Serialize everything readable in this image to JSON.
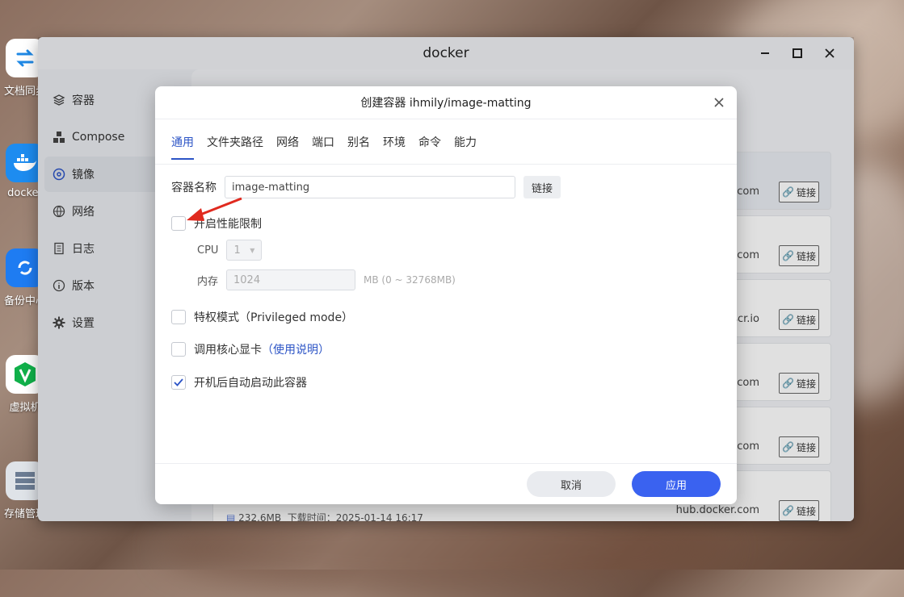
{
  "desktop": {
    "icons": [
      {
        "label": "文档同步"
      },
      {
        "label": "docker"
      },
      {
        "label": "备份中心"
      },
      {
        "label": "虚拟机"
      },
      {
        "label": "存储管理"
      }
    ]
  },
  "window": {
    "title": "docker",
    "sidebar": [
      {
        "label": "容器",
        "icon": "layers-icon"
      },
      {
        "label": "Compose",
        "icon": "boxes-icon"
      },
      {
        "label": "镜像",
        "icon": "disc-icon"
      },
      {
        "label": "网络",
        "icon": "globe-icon"
      },
      {
        "label": "日志",
        "icon": "document-icon"
      },
      {
        "label": "版本",
        "icon": "info-icon"
      },
      {
        "label": "设置",
        "icon": "gear-icon"
      }
    ],
    "image_rows": [
      {
        "source": "docker.com",
        "link_label": "链接"
      },
      {
        "source": "docker.com",
        "link_label": "链接"
      },
      {
        "source": "lscr.io",
        "link_label": "链接"
      },
      {
        "source": "docker.com",
        "link_label": "链接"
      },
      {
        "source": "docker.com",
        "link_label": "链接"
      },
      {
        "source": "hub.docker.com",
        "link_label": "链接",
        "size": "232.6MB",
        "download_time": "下载时间：2025-01-14 16:17"
      }
    ]
  },
  "modal": {
    "title": "创建容器 ihmily/image-matting",
    "tabs": [
      "通用",
      "文件夹路径",
      "网络",
      "端口",
      "别名",
      "环境",
      "命令",
      "能力"
    ],
    "active_tab": "通用",
    "container_name_label": "容器名称",
    "container_name_value": "image-matting",
    "link_button": "链接",
    "perf_limit_label": "开启性能限制",
    "cpu_label": "CPU",
    "cpu_value": "1",
    "memory_label": "内存",
    "memory_value": "1024",
    "memory_hint": "MB (0 ~ 32768MB)",
    "privileged_label": "特权模式（Privileged mode）",
    "gpu_label": "调用核心显卡",
    "gpu_help_link": "（使用说明）",
    "autostart_label": "开机后自动启动此容器",
    "cancel": "取消",
    "apply": "应用"
  },
  "colors": {
    "accent": "#3a62f0",
    "tab_active": "#2c54c6",
    "annotation_arrow": "#e02a1f"
  }
}
